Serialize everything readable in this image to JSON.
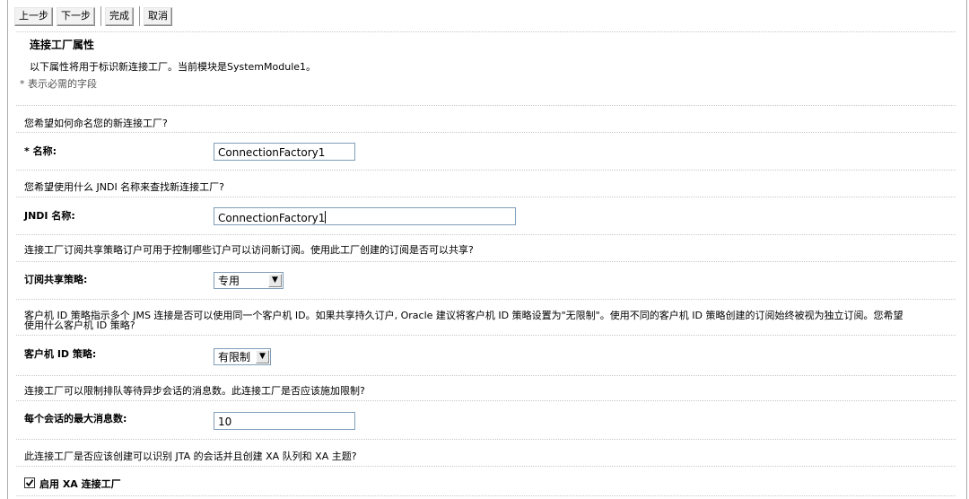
{
  "toolbar": {
    "back": "上一步",
    "next": "下一步",
    "finish": "完成",
    "cancel": "取消"
  },
  "section": {
    "title": "连接工厂属性",
    "description": "以下属性将用于标识新连接工厂。当前模块是SystemModule1。",
    "required_note": "* 表示必需的字段"
  },
  "name": {
    "question": "您希望如何命名您的新连接工厂?",
    "label": "* 名称:",
    "value": "ConnectionFactory1"
  },
  "jndi": {
    "question": "您希望使用什么 JNDI 名称来查找新连接工厂?",
    "label": "JNDI 名称:",
    "value": "ConnectionFactory1"
  },
  "subscription": {
    "question": "连接工厂订阅共享策略订户可用于控制哪些订户可以访问新订阅。使用此工厂创建的订阅是否可以共享?",
    "label": "订阅共享策略:",
    "selected": "专用"
  },
  "client_id": {
    "question_line1": "客户机 ID 策略指示多个 JMS 连接是否可以使用同一个客户机 ID。如果共享持久订户, Oracle 建议将客户机 ID 策略设置为\"无限制\"。使用不同的客户机 ID 策略创建的订阅始终被视为独立订阅。您希望",
    "question_line2": "使用什么客户机 ID 策略?",
    "label": "客户机 ID 策略:",
    "selected": "有限制"
  },
  "max_messages": {
    "question": "连接工厂可以限制排队等待异步会话的消息数。此连接工厂是否应该施加限制?",
    "label": "每个会话的最大消息数:",
    "value": "10"
  },
  "xa": {
    "question": "此连接工厂是否应该创建可以识别 JTA 的会话并且创建 XA 队列和 XA 主题?",
    "label": "启用 XA 连接工厂",
    "checked": true
  }
}
